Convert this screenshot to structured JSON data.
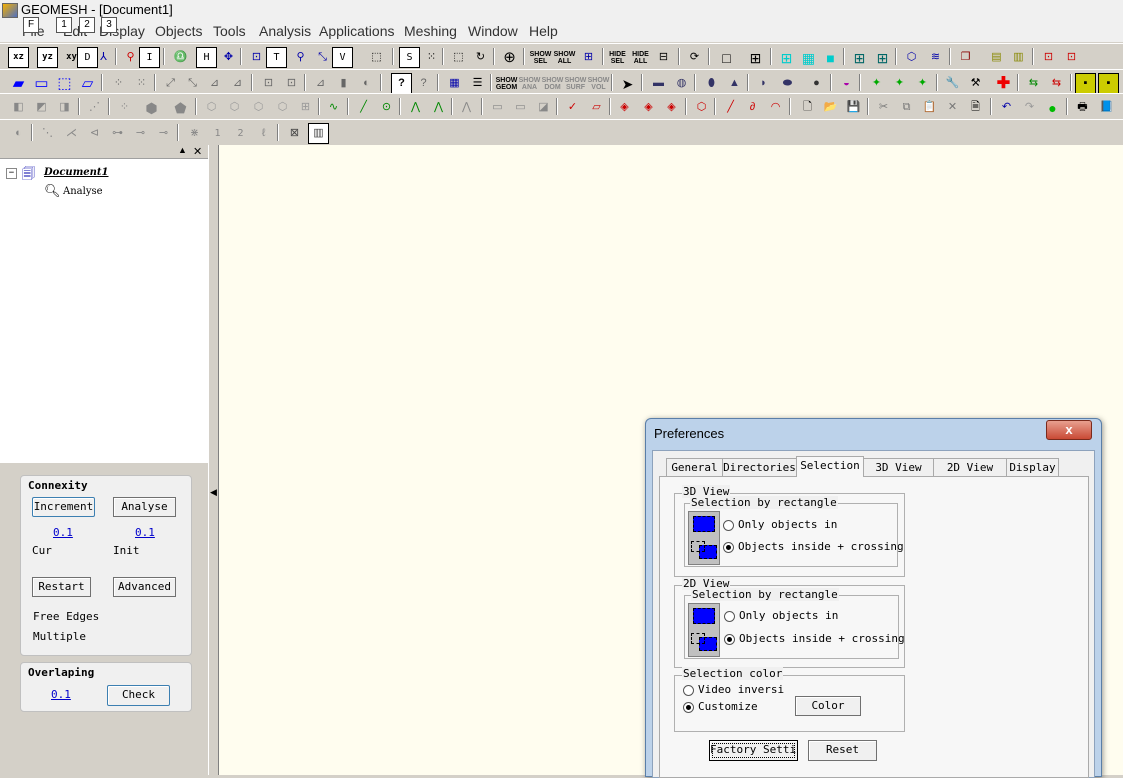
{
  "window": {
    "title": "GEOMESH - [Document1]"
  },
  "menu": {
    "items": [
      "File",
      "Edit",
      "Display",
      "Objects",
      "Tools",
      "Analysis",
      "Applications",
      "Meshing",
      "Window",
      "Help"
    ],
    "keytips": [
      "F",
      "1",
      "2",
      "3"
    ]
  },
  "toolbar": {
    "plane_xz": "xz",
    "plane_yz": "yz",
    "plane_xy": "xy",
    "btn_d": "D",
    "btn_i": "I",
    "btn_h": "H",
    "btn_t": "T",
    "btn_v": "V",
    "btn_s": "S",
    "show_sel": [
      "SHOW",
      "SEL"
    ],
    "show_all": [
      "SHOW",
      "ALL"
    ],
    "hide_sel": [
      "HIDE",
      "SEL"
    ],
    "hide_all": [
      "HIDE",
      "ALL"
    ],
    "show_geom": [
      "SHOW",
      "GEOM"
    ],
    "show_ana": [
      "SHOW",
      "ANA"
    ],
    "show_dom": [
      "SHOW",
      "DOM"
    ],
    "show_surf": [
      "SHOW",
      "SURF"
    ],
    "show_vol": [
      "SHOW",
      "VOL"
    ],
    "power_1": "1",
    "power_2": "2"
  },
  "tree": {
    "root": "Document1",
    "child": "Analyse"
  },
  "connexity": {
    "title": "Connexity",
    "increment_label": "Increment",
    "analyse_label": "Analyse",
    "cur_value": "0.1",
    "init_value": "0.1",
    "cur_label": "Cur",
    "init_label": "Init",
    "restart_label": "Restart",
    "advanced_label": "Advanced",
    "free_edges": "Free Edges",
    "multiple": "Multiple"
  },
  "overlaping": {
    "title": "Overlaping",
    "value": "0.1",
    "check_label": "Check"
  },
  "preferences": {
    "title": "Preferences",
    "close": "x",
    "tabs": [
      "General",
      "Directories",
      "Selection",
      "3D View",
      "2D View",
      "Display"
    ],
    "active_tab": "Selection",
    "view3d": {
      "title": "3D View",
      "group": "Selection by rectangle",
      "option1": "Only objects in",
      "option2": "Objects inside + crossing",
      "selected": 2
    },
    "view2d": {
      "title": "2D View",
      "group": "Selection by rectangle",
      "option1": "Only objects in",
      "option2": "Objects inside + crossing",
      "selected": 2
    },
    "selection_color": {
      "title": "Selection color",
      "option1": "Video inversi",
      "option2": "Customize",
      "selected": 2,
      "color_button": "Color"
    },
    "factory_button": "Factory Settin",
    "reset_button": "Reset"
  }
}
